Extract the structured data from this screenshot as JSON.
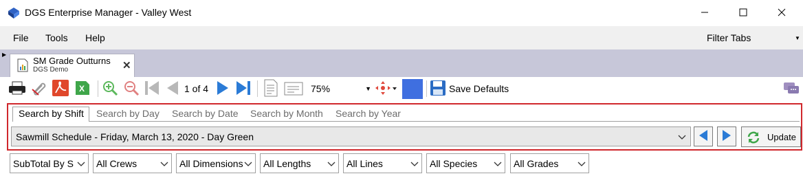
{
  "window": {
    "title": "DGS Enterprise Manager - Valley West"
  },
  "menu": {
    "items": [
      "File",
      "Tools",
      "Help"
    ],
    "filter_tabs": "Filter Tabs"
  },
  "document_tab": {
    "title": "SM Grade Outturns",
    "subtitle": "DGS Demo"
  },
  "toolbar": {
    "page_info": "1 of 4",
    "zoom": "75%",
    "save_defaults": "Save Defaults",
    "color_swatch": "#3f6fe0"
  },
  "search": {
    "tabs": [
      "Search by Shift",
      "Search by Day",
      "Search by Date",
      "Search by Month",
      "Search by Year"
    ],
    "active_tab": "Search by Shift",
    "schedule": "Sawmill Schedule - Friday, March 13, 2020 - Day Green",
    "update_label": "Update"
  },
  "filters": [
    "SubTotal By S",
    "All Crews",
    "All Dimensions",
    "All Lengths",
    "All Lines",
    "All Species",
    "All Grades"
  ]
}
